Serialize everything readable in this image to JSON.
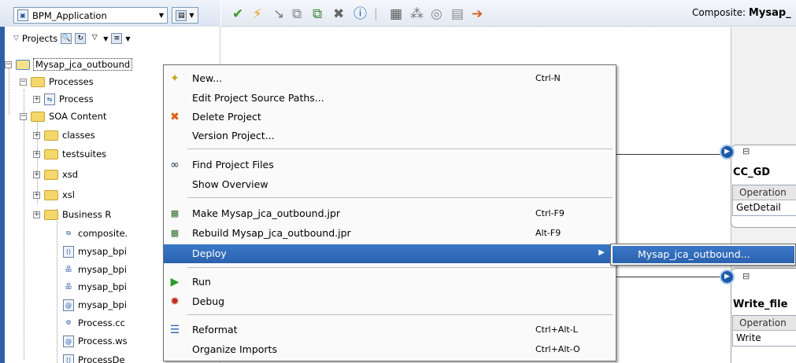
{
  "app_selector": {
    "value": "BPM_Application"
  },
  "projects": {
    "label": "Projects"
  },
  "tree": {
    "root": "Mysap_jca_outbound",
    "processes": "Processes",
    "process": "Process",
    "soa_content": "SOA Content",
    "classes": "classes",
    "testsuites": "testsuites",
    "xsd": "xsd",
    "xsl": "xsl",
    "business_rules": "Business R",
    "composite": "composite.",
    "mysap1": "mysap_bpi",
    "mysap2": "mysap_bpi",
    "mysap3": "mysap_bpi",
    "mysap4": "mysap_bpi",
    "processco": "Process.cc",
    "processws": "Process.ws",
    "processde": "ProcessDe"
  },
  "toolbar": {
    "composite_label": "Composite:",
    "composite_value": "Mysap_"
  },
  "context_menu": {
    "items": [
      {
        "label": "New...",
        "shortcut": "Ctrl-N",
        "icon": "new-icon"
      },
      {
        "label": "Edit Project Source Paths...",
        "shortcut": ""
      },
      {
        "label": "Delete Project",
        "shortcut": "",
        "icon": "delete-icon"
      },
      {
        "label": "Version Project...",
        "shortcut": ""
      },
      {
        "label": "Find Project Files",
        "shortcut": "",
        "icon": "binoculars-icon"
      },
      {
        "label": "Show Overview",
        "shortcut": ""
      },
      {
        "label": "Make Mysap_jca_outbound.jpr",
        "shortcut": "Ctrl-F9",
        "icon": "make-icon"
      },
      {
        "label": "Rebuild Mysap_jca_outbound.jpr",
        "shortcut": "Alt-F9",
        "icon": "rebuild-icon"
      },
      {
        "label": "Deploy",
        "shortcut": ""
      },
      {
        "label": "Run",
        "shortcut": "",
        "icon": "run-icon"
      },
      {
        "label": "Debug",
        "shortcut": "",
        "icon": "debug-icon"
      },
      {
        "label": "Reformat",
        "shortcut": "Ctrl+Alt-L",
        "icon": "reformat-icon"
      },
      {
        "label": "Organize Imports",
        "shortcut": "Ctrl+Alt-O"
      }
    ]
  },
  "deploy_submenu": {
    "item": "Mysap_jca_outbound..."
  },
  "canvas": {
    "card1": {
      "title": "CC_GD",
      "op_header": "Operation",
      "op_value": "GetDetail"
    },
    "card2": {
      "title": "Write_file",
      "op_header": "Operation",
      "op_value": "Write"
    }
  },
  "colors": {
    "selection": "#2b62ad",
    "accent": "#1d5aa8"
  }
}
